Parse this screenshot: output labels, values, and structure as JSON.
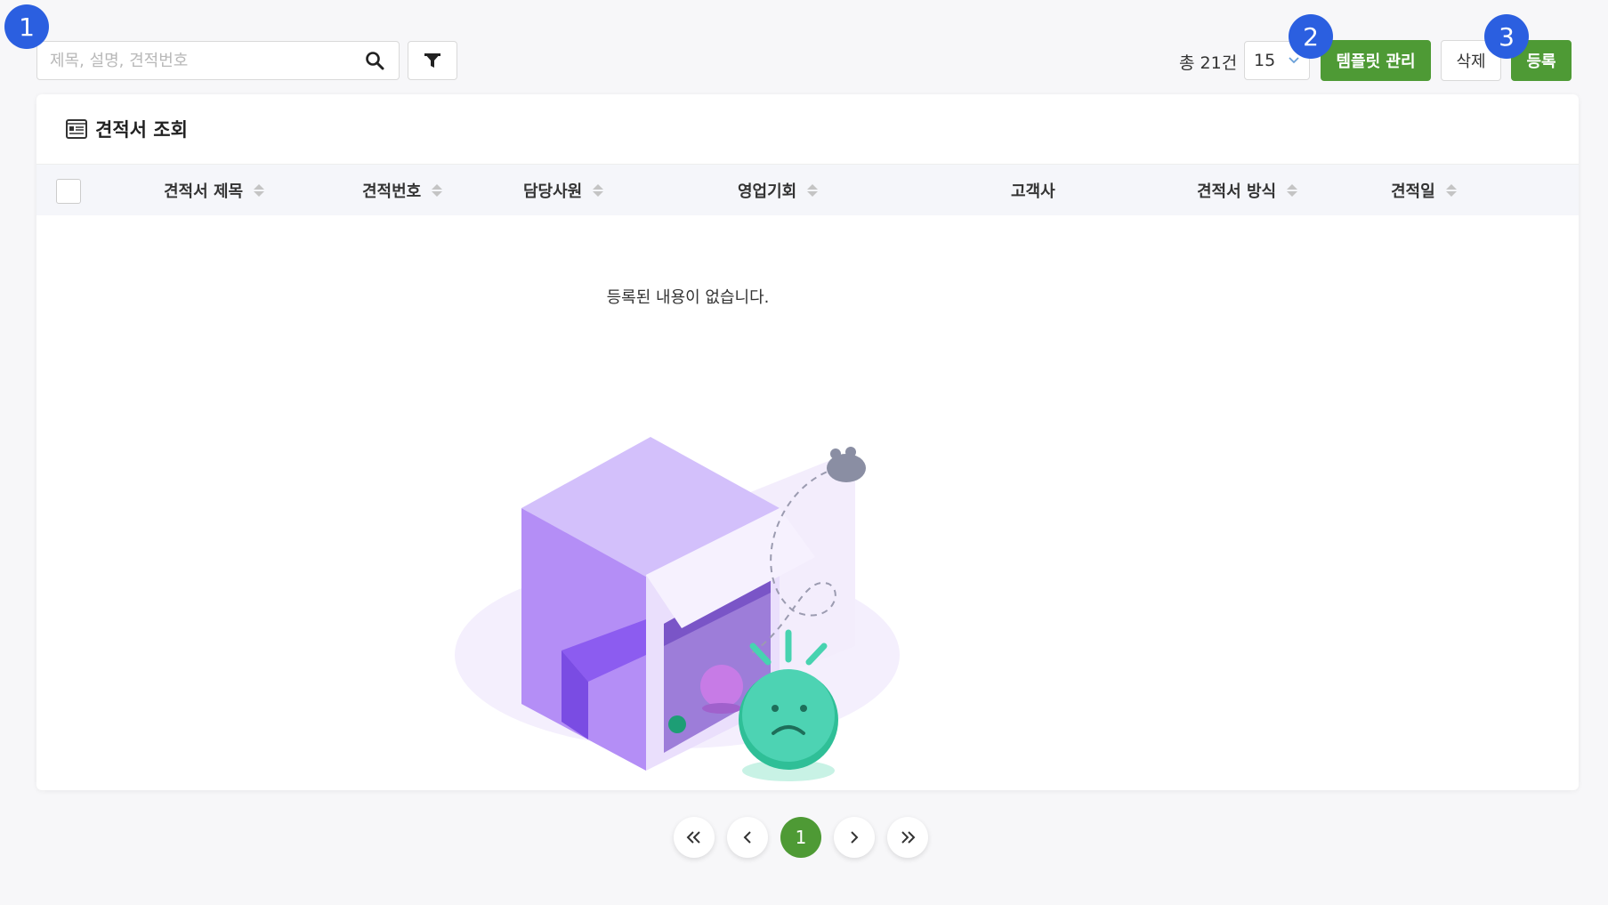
{
  "toolbar": {
    "search_placeholder": "제목, 설명, 견적번호",
    "search_icon": "search-icon",
    "filter_icon": "filter-icon",
    "total_count": "총 21건",
    "page_size": "15",
    "template_button": "템플릿 관리",
    "delete_button": "삭제",
    "register_button": "등록"
  },
  "badges": [
    "1",
    "2",
    "3"
  ],
  "card": {
    "title": "견적서 조회",
    "title_icon": "document-icon",
    "columns": [
      {
        "label": "견적서 제목",
        "sortable": true
      },
      {
        "label": "견적번호",
        "sortable": true
      },
      {
        "label": "담당사원",
        "sortable": true
      },
      {
        "label": "영업기회",
        "sortable": true
      },
      {
        "label": "고객사",
        "sortable": false
      },
      {
        "label": "견적서 방식",
        "sortable": true
      },
      {
        "label": "견적일",
        "sortable": true
      }
    ],
    "empty_message": "등록된 내용이 없습니다."
  },
  "pagination": {
    "current": "1"
  },
  "colors": {
    "accent": "#4e9a35",
    "badge": "#2b5fe0"
  }
}
